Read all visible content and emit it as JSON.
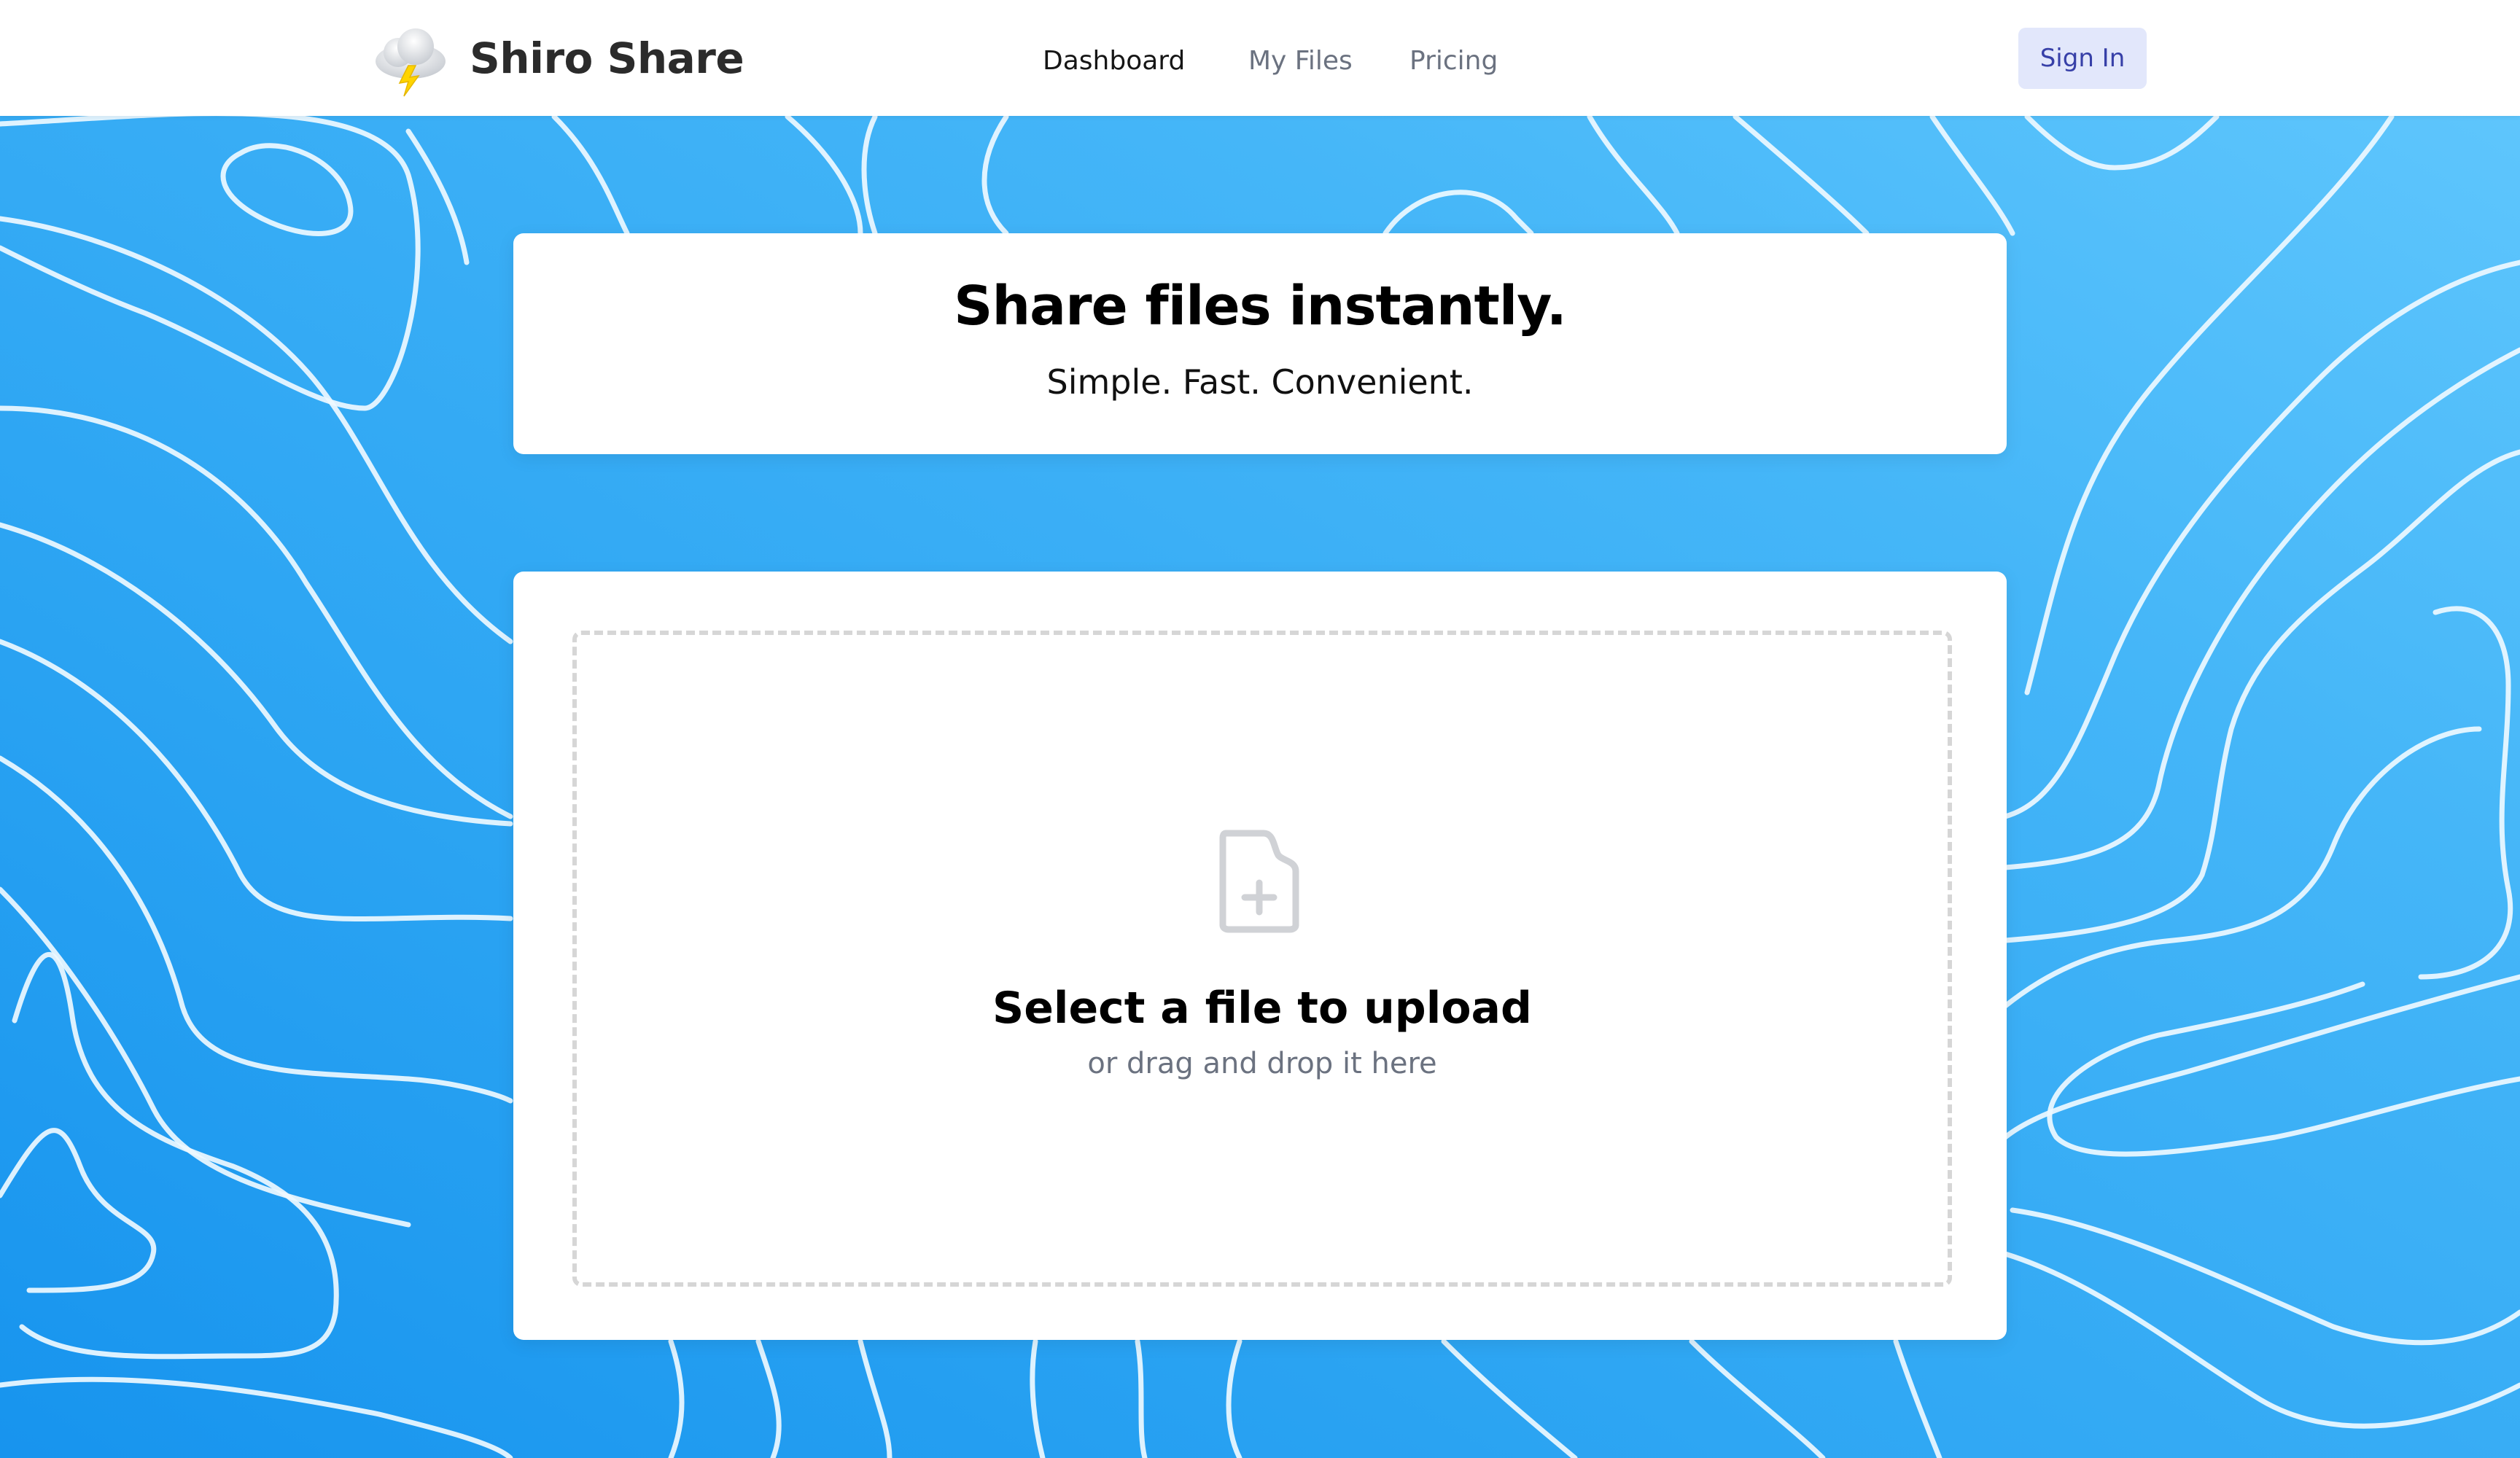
{
  "brand": {
    "name": "Shiro Share",
    "logo_icon": "cloud-lightning-icon"
  },
  "nav": {
    "items": [
      {
        "label": "Dashboard",
        "active": true
      },
      {
        "label": "My Files",
        "active": false
      },
      {
        "label": "Pricing",
        "active": false
      }
    ]
  },
  "auth": {
    "sign_in_label": "Sign In"
  },
  "hero": {
    "title": "Share files instantly.",
    "subtitle": "Simple. Fast. Convenient."
  },
  "upload": {
    "icon": "file-add-icon",
    "title": "Select a file to upload",
    "subtitle": "or drag and drop it here"
  },
  "colors": {
    "background_start": "#1794ee",
    "background_end": "#62c8fd",
    "contour_lines": "#eaf6ff",
    "accent_button_bg": "#e2e7fb",
    "accent_button_text": "#3740a8",
    "muted_text": "#6b7280",
    "dropzone_border": "#d6d6d6"
  }
}
